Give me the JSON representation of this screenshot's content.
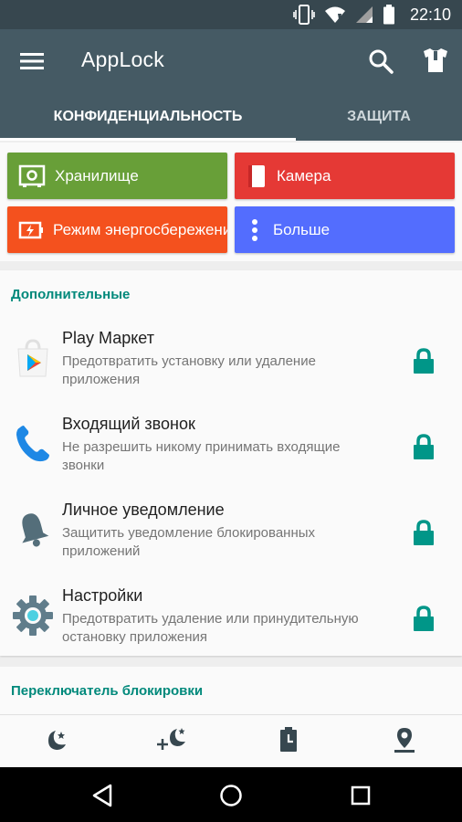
{
  "status_bar": {
    "time": "22:10"
  },
  "app_bar": {
    "title": "AppLock"
  },
  "tabs": [
    {
      "label": "КОНФИДЕНЦИАЛЬНОСТЬ",
      "active": true
    },
    {
      "label": "ЗАЩИТА",
      "active": false
    }
  ],
  "tiles": [
    {
      "label": "Хранилище",
      "icon": "vault-icon",
      "color": "#689f38"
    },
    {
      "label": "Камера",
      "icon": "camera-icon",
      "color": "#e53935"
    },
    {
      "label": "Режим энергосбережения",
      "icon": "battery-saver-icon",
      "color": "#f4511e"
    },
    {
      "label": "Больше",
      "icon": "more-vertical-icon",
      "color": "#536dfe"
    }
  ],
  "additional": {
    "title": "Дополнительные",
    "items": [
      {
        "title": "Play Маркет",
        "desc": "Предотвратить установку или удаление приложения",
        "icon": "play-market-icon"
      },
      {
        "title": "Входящий звонок",
        "desc": "Не разрешить никому принимать входящие звонки",
        "icon": "phone-icon"
      },
      {
        "title": "Личное уведомление",
        "desc": "Защитить уведомление блокированных приложений",
        "icon": "bell-icon"
      },
      {
        "title": "Настройки",
        "desc": "Предотвратить удаление или принудительную остановку приложения",
        "icon": "settings-gear-icon"
      }
    ]
  },
  "lock_switch": {
    "title": "Переключатель блокировки"
  },
  "colors": {
    "primary": "#455a64",
    "status_bar": "#37474f",
    "accent": "#009688",
    "section_title": "#00897b"
  }
}
